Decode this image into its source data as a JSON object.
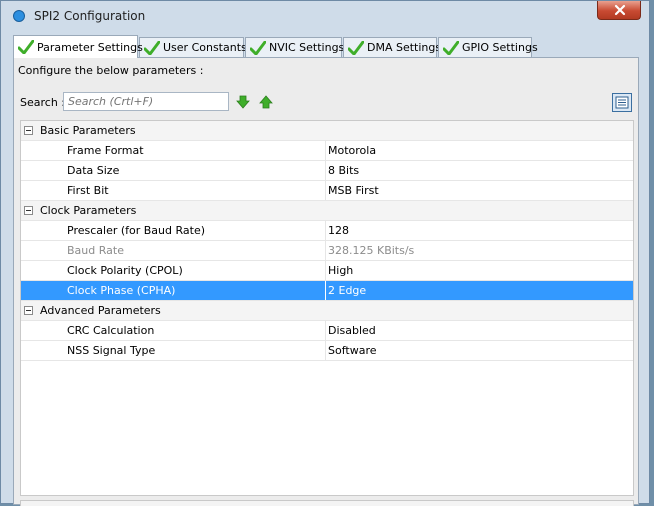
{
  "window": {
    "title": "SPI2 Configuration"
  },
  "tabs": [
    {
      "label": "Parameter Settings",
      "active": true
    },
    {
      "label": "User Constants",
      "active": false
    },
    {
      "label": "NVIC Settings",
      "active": false
    },
    {
      "label": "DMA Settings",
      "active": false
    },
    {
      "label": "GPIO Settings",
      "active": false
    }
  ],
  "panel": {
    "configure_text": "Configure the below parameters :",
    "search_label": "Search :",
    "search_placeholder": "Search (Crtl+F)"
  },
  "groups": [
    {
      "label": "Basic Parameters",
      "params": [
        {
          "name": "Frame Format",
          "value": "Motorola"
        },
        {
          "name": "Data Size",
          "value": "8 Bits"
        },
        {
          "name": "First Bit",
          "value": "MSB First"
        }
      ]
    },
    {
      "label": "Clock Parameters",
      "params": [
        {
          "name": "Prescaler (for Baud Rate)",
          "value": "128"
        },
        {
          "name": "Baud Rate",
          "value": "328.125 KBits/s",
          "disabled": true
        },
        {
          "name": "Clock Polarity (CPOL)",
          "value": "High"
        },
        {
          "name": "Clock Phase (CPHA)",
          "value": "2 Edge",
          "selected": true
        }
      ]
    },
    {
      "label": "Advanced Parameters",
      "params": [
        {
          "name": "CRC Calculation",
          "value": "Disabled"
        },
        {
          "name": "NSS Signal Type",
          "value": "Software"
        }
      ]
    }
  ],
  "colors": {
    "selection": "#3399ff",
    "check_green": "#3fae2a"
  },
  "icons": {
    "tab_check": "check-icon",
    "find_next": "arrow-down-icon",
    "find_prev": "arrow-up-icon"
  }
}
